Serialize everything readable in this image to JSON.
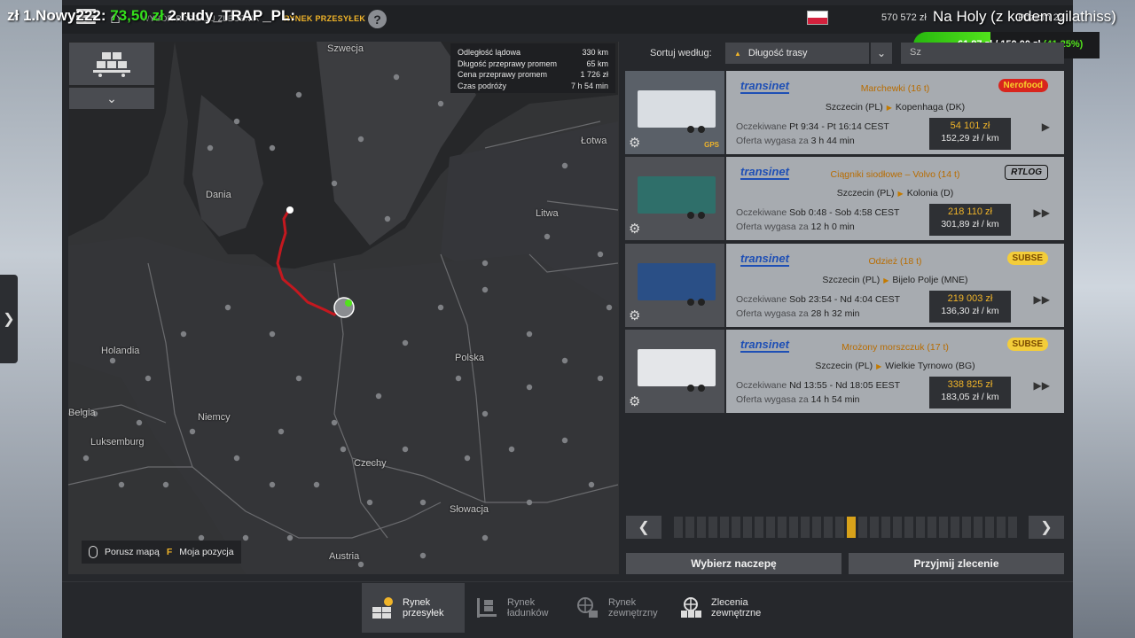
{
  "overlay": {
    "left_prefix": "zł",
    "left_main": "1.Nowy222:",
    "left_amount": "73,50 zł",
    "left_rest": "2.rudy_TRAP_PL:",
    "right_text": "Na Holy (z kodem gilathiss)",
    "progress_text": "61,87 zł / 150,00 zł",
    "progress_pct_text": "(41.25%)",
    "progress_fraction": 0.4125
  },
  "header": {
    "breadcrumb_1": "WYBÓR RODZAJU ZLECENIA",
    "breadcrumb_2": "RYNEK PRZESYŁEK",
    "help": "?",
    "money": "570 572 zł",
    "money_tail": "Poziom 22"
  },
  "map": {
    "labels": [
      {
        "text": "Szwecja"
      },
      {
        "text": "Łotwa"
      },
      {
        "text": "Dania"
      },
      {
        "text": "Litwa"
      },
      {
        "text": "Holandia"
      },
      {
        "text": "Polska"
      },
      {
        "text": "Belgia"
      },
      {
        "text": "Niemcy"
      },
      {
        "text": "Luksemburg"
      },
      {
        "text": "Czechy"
      },
      {
        "text": "Słowacja"
      },
      {
        "text": "Austria"
      }
    ],
    "legend_move": "Porusz mapą",
    "legend_key": "F",
    "legend_pos": "Moja pozycja"
  },
  "route_info": [
    {
      "label": "Odległość lądowa",
      "value": "330 km"
    },
    {
      "label": "Długość przeprawy promem",
      "value": "65 km"
    },
    {
      "label": "Cena przeprawy promem",
      "value": "1 726 zł"
    },
    {
      "label": "Czas podróży",
      "value": "7 h 54 min"
    }
  ],
  "sort": {
    "label": "Sortuj według:",
    "value": "Długość trasy",
    "search": "Sz"
  },
  "jobs": [
    {
      "company": "transinet",
      "cargo": "Marchewki (16 t)",
      "from": "Szczecin (PL)",
      "to": "Kopenhaga (DK)",
      "expected_label": "Oczekiwane",
      "expected": "Pt 9:34 - Pt 16:14 CEST",
      "expires_label": "Oferta wygasa za",
      "expires": "3 h 44 min",
      "price": "54 101 zł",
      "per_km": "152,29 zł / km",
      "logo": "Nerofood",
      "arrow": "▶"
    },
    {
      "company": "transinet",
      "cargo": "Ciągniki siodłowe – Volvo (14 t)",
      "from": "Szczecin (PL)",
      "to": "Kolonia (D)",
      "expected_label": "Oczekiwane",
      "expected": "Sob 0:48 - Sob 4:58 CEST",
      "expires_label": "Oferta wygasa za",
      "expires": "12 h 0 min",
      "price": "218 110 zł",
      "per_km": "301,89 zł / km",
      "logo": "RTLOG",
      "arrow": "▶▶"
    },
    {
      "company": "transinet",
      "cargo": "Odzież (18 t)",
      "from": "Szczecin (PL)",
      "to": "Bijelo Polje (MNE)",
      "expected_label": "Oczekiwane",
      "expected": "Sob 23:54 - Nd 4:04 CEST",
      "expires_label": "Oferta wygasa za",
      "expires": "28 h 32 min",
      "price": "219 003 zł",
      "per_km": "136,30 zł / km",
      "logo": "SUBSE",
      "arrow": "▶▶"
    },
    {
      "company": "transinet",
      "cargo": "Mrożony morszczuk (17 t)",
      "from": "Szczecin (PL)",
      "to": "Wielkie Tyrnowo (BG)",
      "expected_label": "Oczekiwane",
      "expected": "Nd 13:55 - Nd 18:05 EEST",
      "expires_label": "Oferta wygasa za",
      "expires": "14 h 54 min",
      "price": "338 825 zł",
      "per_km": "183,05 zł / km",
      "logo": "SUBSE",
      "arrow": "▶▶"
    }
  ],
  "gps_label": "GPS",
  "pager": {
    "pages": 30,
    "current": 15
  },
  "buttons": {
    "choose_trailer": "Wybierz naczepę",
    "accept": "Przyjmij zlecenie"
  },
  "tabs": [
    {
      "line1": "Rynek",
      "line2": "przesyłek"
    },
    {
      "line1": "Rynek",
      "line2": "ładunków"
    },
    {
      "line1": "Rynek",
      "line2": "zewnętrzny"
    },
    {
      "line1": "Zlecenia",
      "line2": "zewnętrzne"
    }
  ],
  "colors": {
    "accent": "#f0b429",
    "route": "#c4181f",
    "progress": "#52e31c"
  }
}
